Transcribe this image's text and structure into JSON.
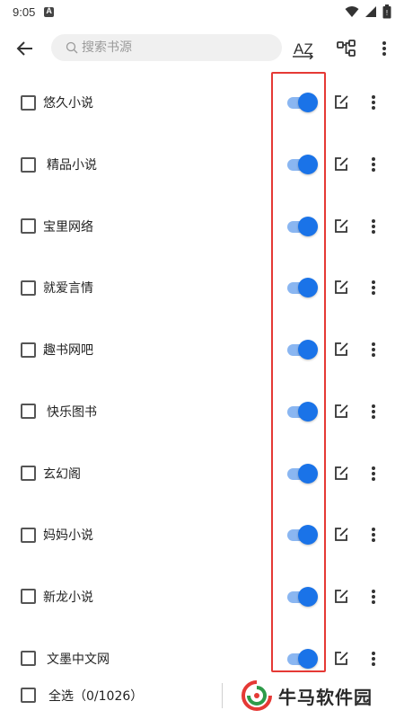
{
  "status_bar": {
    "time": "9:05"
  },
  "search": {
    "placeholder": "搜索书源",
    "value": ""
  },
  "toolbar": {
    "sort_label": "AZ"
  },
  "sources": [
    {
      "name": "悠久小说",
      "checked": false,
      "enabled": true
    },
    {
      "name": "精品小说",
      "checked": false,
      "enabled": true
    },
    {
      "name": "宝里网络",
      "checked": false,
      "enabled": true
    },
    {
      "name": "就爱言情",
      "checked": false,
      "enabled": true
    },
    {
      "name": "趣书网吧",
      "checked": false,
      "enabled": true
    },
    {
      "name": "快乐图书",
      "checked": false,
      "enabled": true
    },
    {
      "name": "玄幻阁",
      "checked": false,
      "enabled": true
    },
    {
      "name": "妈妈小说",
      "checked": false,
      "enabled": true
    },
    {
      "name": "新龙小说",
      "checked": false,
      "enabled": true
    },
    {
      "name": "文墨中文网",
      "checked": false,
      "enabled": true
    }
  ],
  "bottom_bar": {
    "select_all_label": "全选（0/1026）"
  },
  "watermark": {
    "text": "牛马软件园"
  },
  "colors": {
    "accent": "#1a73e8",
    "track": "#8ab6f1",
    "highlight": "#e53935"
  }
}
